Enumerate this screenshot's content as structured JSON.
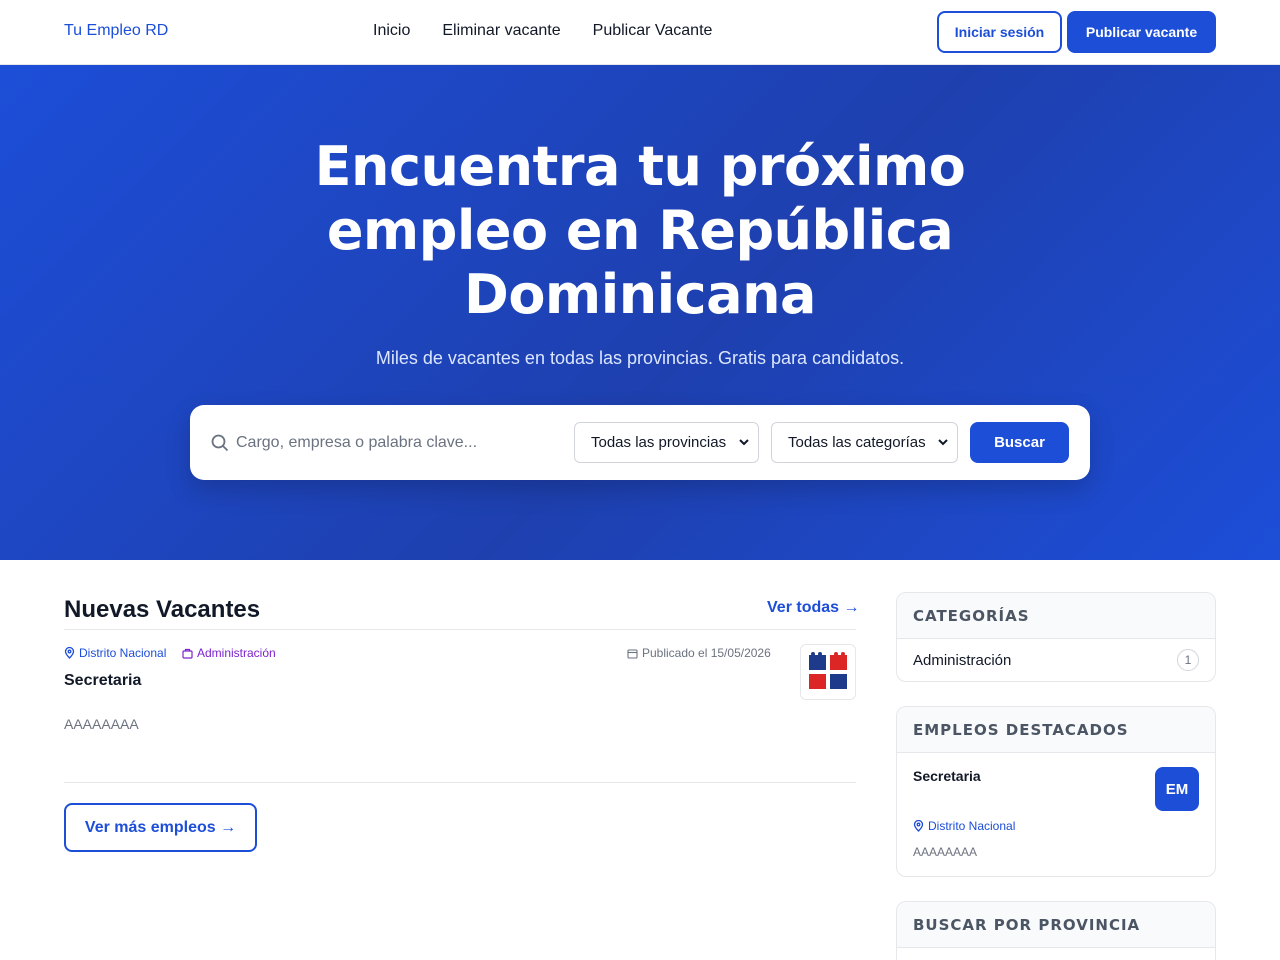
{
  "header": {
    "brand": "Tu Empleo RD",
    "nav": [
      "Inicio",
      "Eliminar vacante",
      "Publicar Vacante"
    ],
    "login_label": "Iniciar sesión",
    "post_label": "Publicar vacante",
    "brand_color": "#1d4ed8"
  },
  "hero": {
    "title_line1": "Encuentra tu próximo",
    "title_line2": "empleo en República",
    "title_line3": "Dominicana",
    "subtitle": "Miles de vacantes en todas las provincias. Gratis para candidatos.",
    "search": {
      "placeholder": "Cargo, empresa o palabra clave...",
      "province_selected": "Todas las provincias",
      "category_selected": "Todas las categorías",
      "button_label": "Buscar"
    }
  },
  "main": {
    "section_title": "Nuevas Vacantes",
    "see_all_label": "Ver todas →",
    "jobs": [
      {
        "location": "Distrito Nacional",
        "category": "Administración",
        "published": "Publicado el 15/05/2026",
        "title": "Secretaria",
        "description": "AAAAAAAA"
      }
    ],
    "more_label": "Ver más empleos →"
  },
  "sidebar": {
    "categories": {
      "heading": "CATEGORÍAS",
      "items": [
        {
          "name": "Administración",
          "count": "1"
        }
      ]
    },
    "featured": {
      "heading": "EMPLEOS DESTACADOS",
      "job_title": "Secretaria",
      "avatar_text": "EM",
      "location": "Distrito Nacional",
      "description": "AAAAAAAA"
    },
    "provinces": {
      "heading": "BUSCAR POR PROVINCIA"
    }
  }
}
